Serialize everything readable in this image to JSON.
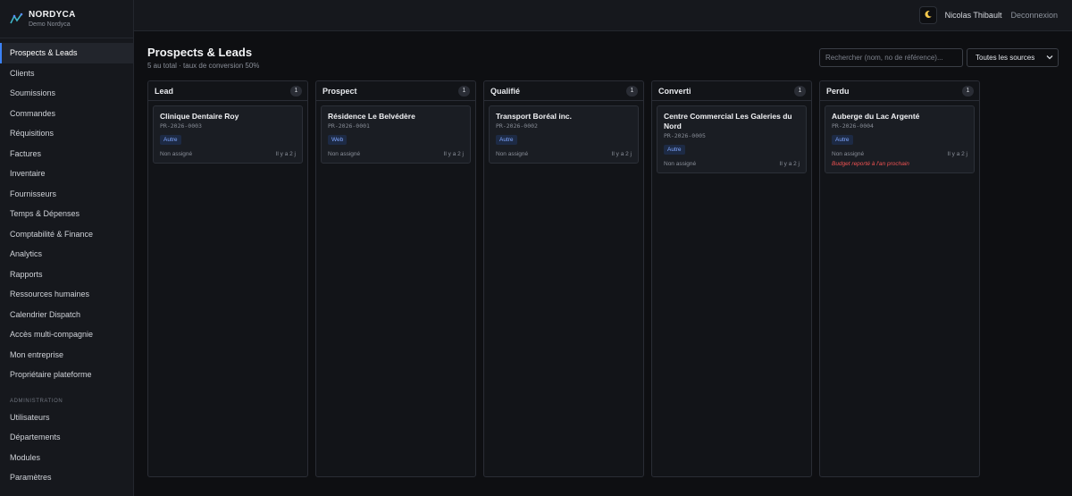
{
  "app": {
    "brand_name": "NORDYCA",
    "brand_sub": "Demo Nordyca"
  },
  "sidebar": {
    "items": [
      {
        "label": "Prospects & Leads",
        "active": true
      },
      {
        "label": "Clients"
      },
      {
        "label": "Soumissions"
      },
      {
        "label": "Commandes"
      },
      {
        "label": "Réquisitions"
      },
      {
        "label": "Factures"
      },
      {
        "label": "Inventaire"
      },
      {
        "label": "Fournisseurs"
      },
      {
        "label": "Temps & Dépenses"
      },
      {
        "label": "Comptabilité & Finance"
      },
      {
        "label": "Analytics"
      },
      {
        "label": "Rapports"
      },
      {
        "label": "Ressources humaines"
      },
      {
        "label": "Calendrier Dispatch"
      },
      {
        "label": "Accès multi-compagnie"
      },
      {
        "label": "Mon entreprise"
      },
      {
        "label": "Propriétaire plateforme"
      }
    ],
    "admin_section": "ADMINISTRATION",
    "admin_items": [
      {
        "label": "Utilisateurs"
      },
      {
        "label": "Départements"
      },
      {
        "label": "Modules"
      },
      {
        "label": "Paramètres"
      }
    ]
  },
  "topbar": {
    "theme_icon": "moon-icon",
    "user_name": "Nicolas Thibault",
    "logout_label": "Deconnexion"
  },
  "page": {
    "title": "Prospects & Leads",
    "subtitle": "5 au total · taux de conversion 50%",
    "search_placeholder": "Rechercher (nom, no de référence)...",
    "source_select": "Toutes les sources"
  },
  "columns": [
    {
      "title": "Lead",
      "count": "1",
      "cards": [
        {
          "title": "Clinique Dentaire Roy",
          "ref": "PR-2026-0003",
          "tag": "Autre",
          "assignee": "Non assigné",
          "age": "Il y a 2 j"
        }
      ]
    },
    {
      "title": "Prospect",
      "count": "1",
      "cards": [
        {
          "title": "Résidence Le Belvédère",
          "ref": "PR-2026-0001",
          "tag": "Web",
          "assignee": "Non assigné",
          "age": "Il y a 2 j"
        }
      ]
    },
    {
      "title": "Qualifié",
      "count": "1",
      "cards": [
        {
          "title": "Transport Boréal inc.",
          "ref": "PR-2026-0002",
          "tag": "Autre",
          "assignee": "Non assigné",
          "age": "Il y a 2 j"
        }
      ]
    },
    {
      "title": "Converti",
      "count": "1",
      "cards": [
        {
          "title": "Centre Commercial Les Galeries du Nord",
          "ref": "PR-2026-0005",
          "tag": "Autre",
          "assignee": "Non assigné",
          "age": "Il y a 2 j"
        }
      ]
    },
    {
      "title": "Perdu",
      "count": "1",
      "cards": [
        {
          "title": "Auberge du Lac Argenté",
          "ref": "PR-2026-0004",
          "tag": "Autre",
          "assignee": "Non assigné",
          "age": "Il y a 2 j",
          "note": "Budget reporté à l'an prochain"
        }
      ]
    }
  ],
  "colors": {
    "accent": "#3b82f6",
    "tag_bg": "#1d2a44",
    "tag_text": "#7fa6ff",
    "lost_note": "#f05252"
  }
}
